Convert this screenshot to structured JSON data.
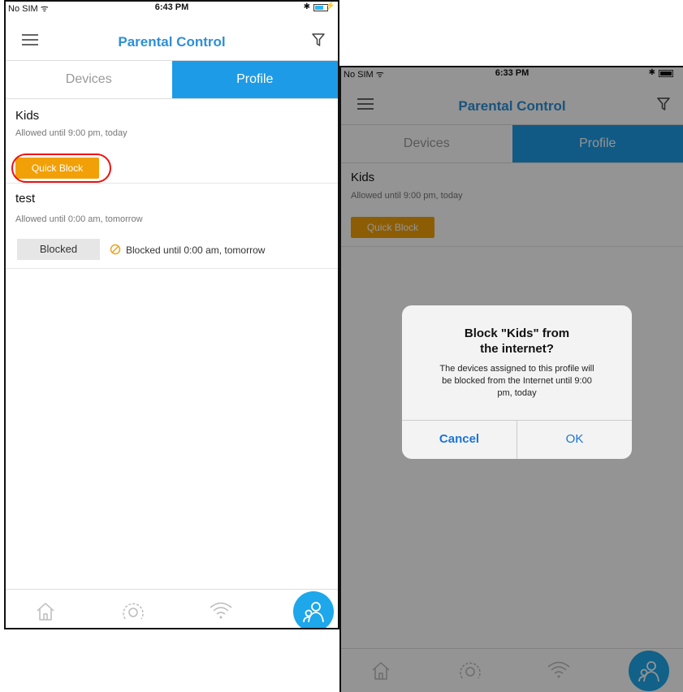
{
  "left_screen": {
    "status": {
      "carrier": "No SIM ᯤ",
      "time": "6:43 PM",
      "bt": "✱"
    },
    "nav": {
      "title": "Parental Control"
    },
    "tabs": [
      {
        "label": "Devices"
      },
      {
        "label": "Profile"
      }
    ],
    "profiles": [
      {
        "name": "Kids",
        "status": "Allowed until 9:00 pm, today",
        "button": "Quick Block"
      },
      {
        "name": "test",
        "status": "Allowed until 0:00 am, tomorrow",
        "button": "Blocked",
        "blocked_text": "Blocked until 0:00 am, tomorrow"
      }
    ]
  },
  "right_screen": {
    "status": {
      "carrier": "No SIM ᯤ",
      "time": "6:33 PM",
      "bt": "✱"
    },
    "nav": {
      "title": "Parental Control"
    },
    "tabs": [
      {
        "label": "Devices"
      },
      {
        "label": "Profile"
      }
    ],
    "profiles": [
      {
        "name": "Kids",
        "status": "Allowed until 9:00 pm, today",
        "button": "Quick Block"
      }
    ],
    "dialog": {
      "title_line1": "Block \"Kids\" from",
      "title_line2": "the internet?",
      "msg_line1": "The devices assigned to this profile will",
      "msg_line2": "be blocked from the Internet until 9:00",
      "msg_line3": "pm, today",
      "cancel": "Cancel",
      "ok": "OK"
    }
  },
  "colors": {
    "accent": "#1e9be6",
    "title_blue": "#2e8fd6",
    "quick_block": "#f2a007",
    "highlight_ring": "#e11111",
    "dialog_button": "#1a74d8"
  },
  "icons": [
    "menu-icon",
    "filter-icon",
    "home-icon",
    "speedometer-icon",
    "wifi-icon",
    "parental-control-icon",
    "block-icon"
  ]
}
